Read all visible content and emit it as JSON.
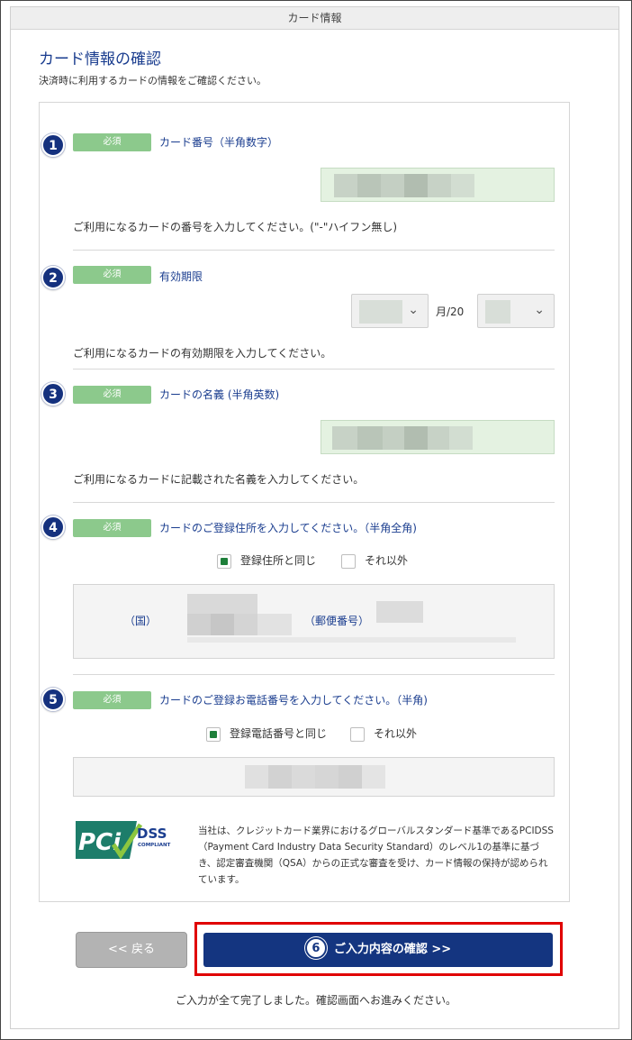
{
  "header": {
    "title": "カード情報"
  },
  "page": {
    "title": "カード情報の確認",
    "subtitle": "決済時に利用するカードの情報をご確認ください。"
  },
  "required_label": "必須",
  "fields": [
    {
      "step": "1",
      "label": "カード番号（半角数字）",
      "help": "ご利用になるカードの番号を入力してください。(\"-\"ハイフン無し)"
    },
    {
      "step": "2",
      "label": "有効期限",
      "help": "ご利用になるカードの有効期限を入力してください。",
      "month_sep": "月/20"
    },
    {
      "step": "3",
      "label": "カードの名義 (半角英数)",
      "help": "ご利用になるカードに記載された名義を入力してください。"
    },
    {
      "step": "4",
      "label": "カードのご登録住所を入力してください。（半角全角)",
      "opt_same": "登録住所と同じ",
      "opt_other": "それ以外",
      "country_label": "（国）",
      "zip_label": "（郵便番号）"
    },
    {
      "step": "5",
      "label": "カードのご登録お電話番号を入力してください。（半角)",
      "opt_same": "登録電話番号と同じ",
      "opt_other": "それ以外"
    }
  ],
  "pci": {
    "logo_main": "PCi",
    "logo_dss": "DSS",
    "logo_sub": "COMPLIANT",
    "text": "当社は、クレジットカード業界におけるグローバルスタンダード基準であるPCIDSS（Payment Card Industry Data Security Standard）のレベル1の基準に基づき、認定審査機関（QSA）からの正式な審査を受け、カード情報の保持が認められています。"
  },
  "buttons": {
    "back": "<< 戻る",
    "confirm_step": "6",
    "confirm": "ご入力内容の確認 >>"
  },
  "footer_note": "ご入力が全て完了しました。確認画面へお進みください。",
  "colors": {
    "accent": "#143580",
    "required": "#8cc98c",
    "highlight": "#e00000"
  }
}
